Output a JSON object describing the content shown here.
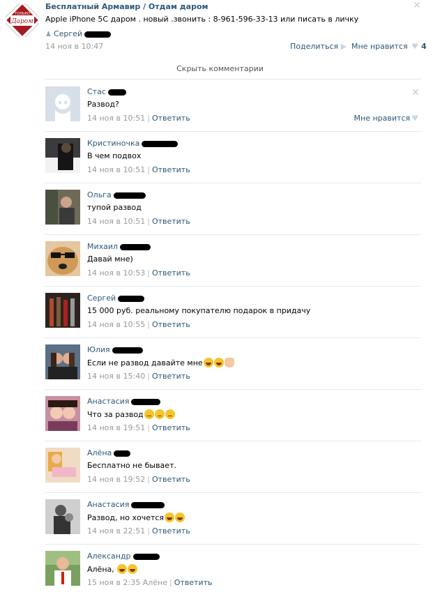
{
  "post": {
    "group_title": "Бесплатный Армавир / Отдам даром",
    "text": "Apple iPhone 5C даром . новый .звонить : 8-961-596-33-13 или писать в личку",
    "author": "Сергей",
    "date": "14 ноя в 10:47",
    "share_label": "Поделиться",
    "like_label": "Мне нравится",
    "like_count": "4",
    "logo_top": "ТОЛЬКО",
    "logo_main": "Даром"
  },
  "hide_comments_label": "Скрыть комментарии",
  "reply_label": "Ответить",
  "like_label": "Мне нравится",
  "comments": [
    {
      "name": "Стас",
      "text": "Развод?",
      "date": "14 ноя в 10:51"
    },
    {
      "name": "Кристиночка",
      "text": "В чем подвох",
      "date": "14 ноя в 10:51"
    },
    {
      "name": "Ольга",
      "text": "тупой развод",
      "date": "14 ноя в 10:51"
    },
    {
      "name": "Михаил",
      "text": "Давай мне)",
      "date": "14 ноя в 10:53"
    },
    {
      "name": "Сергей",
      "text": "15 000 руб. реальному покупателю подарок в придачу",
      "date": "14 ноя в 10:55"
    },
    {
      "name": "Юлия",
      "text": "Если не развод давайте мне",
      "date": "14 ноя в 15:40"
    },
    {
      "name": "Анастасия",
      "text": "Что за развод",
      "date": "14 ноя в 19:51"
    },
    {
      "name": "Алёна",
      "text": "Бесплатно не бывает.",
      "date": "14 ноя в 19:52"
    },
    {
      "name": "Анастасия",
      "text": "Развод, но хочется",
      "date": "14 ноя в 22:51"
    },
    {
      "name": "Александр",
      "text": "Алёна,",
      "date": "15 ноя в 2:35",
      "reply_to": "Алёне"
    }
  ]
}
